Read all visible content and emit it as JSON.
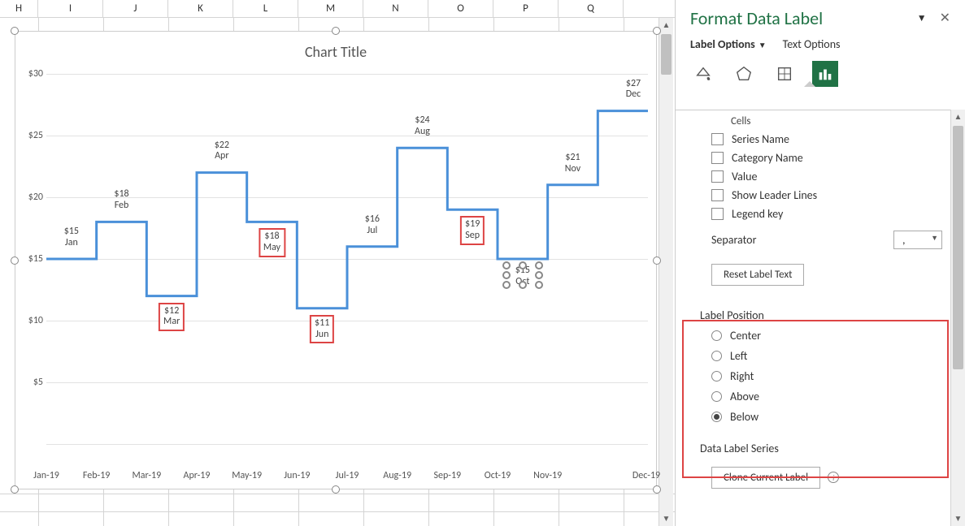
{
  "columns": [
    "H",
    "I",
    "J",
    "K",
    "L",
    "M",
    "N",
    "O",
    "P",
    "Q"
  ],
  "chart": {
    "title": "Chart Title",
    "y_ticks": [
      "$30",
      "$25",
      "$20",
      "$15",
      "$10",
      "$5"
    ],
    "x_ticks": [
      "Jan-19",
      "Feb-19",
      "Mar-19",
      "Apr-19",
      "May-19",
      "Jun-19",
      "Jul-19",
      "Aug-19",
      "Sep-19",
      "Oct-19",
      "Nov-19",
      "Dec-19"
    ],
    "data_labels": [
      {
        "value": "$15",
        "month": "Jan",
        "redbox": false,
        "selected": false
      },
      {
        "value": "$18",
        "month": "Feb",
        "redbox": false,
        "selected": false
      },
      {
        "value": "$12",
        "month": "Mar",
        "redbox": true,
        "selected": false
      },
      {
        "value": "$22",
        "month": "Apr",
        "redbox": false,
        "selected": false
      },
      {
        "value": "$18",
        "month": "May",
        "redbox": true,
        "selected": false
      },
      {
        "value": "$11",
        "month": "Jun",
        "redbox": true,
        "selected": false
      },
      {
        "value": "$16",
        "month": "Jul",
        "redbox": false,
        "selected": false
      },
      {
        "value": "$24",
        "month": "Aug",
        "redbox": false,
        "selected": false
      },
      {
        "value": "$19",
        "month": "Sep",
        "redbox": true,
        "selected": false
      },
      {
        "value": "$15",
        "month": "Oct",
        "redbox": false,
        "selected": true
      },
      {
        "value": "$21",
        "month": "Nov",
        "redbox": false,
        "selected": false
      },
      {
        "value": "$27",
        "month": "Dec",
        "redbox": false,
        "selected": false
      }
    ]
  },
  "chart_data": {
    "type": "line",
    "title": "Chart Title",
    "categories": [
      "Jan-19",
      "Feb-19",
      "Mar-19",
      "Apr-19",
      "May-19",
      "Jun-19",
      "Jul-19",
      "Aug-19",
      "Sep-19",
      "Oct-19",
      "Nov-19",
      "Dec-19"
    ],
    "values": [
      15,
      18,
      12,
      22,
      18,
      11,
      16,
      24,
      19,
      15,
      21,
      27
    ],
    "ylabel": "",
    "xlabel": "",
    "ylim": [
      0,
      30
    ],
    "y_format": "$"
  },
  "pane": {
    "title": "Format Data Label",
    "tabs": {
      "label_options": "Label Options",
      "text_options": "Text Options"
    },
    "partial": "Cells",
    "checkbox": {
      "series_name": "Series Name",
      "category_name": "Category Name",
      "value": "Value",
      "leader_lines": "Show Leader Lines",
      "legend_key": "Legend key"
    },
    "separator": {
      "label": "Separator",
      "value": ","
    },
    "reset_button": "Reset Label Text",
    "label_position": {
      "title": "Label Position",
      "center": "Center",
      "left": "Left",
      "right": "Right",
      "above": "Above",
      "below": "Below",
      "selected": "below"
    },
    "data_label_series": "Data Label Series",
    "clone_button": "Clone Current Label"
  }
}
